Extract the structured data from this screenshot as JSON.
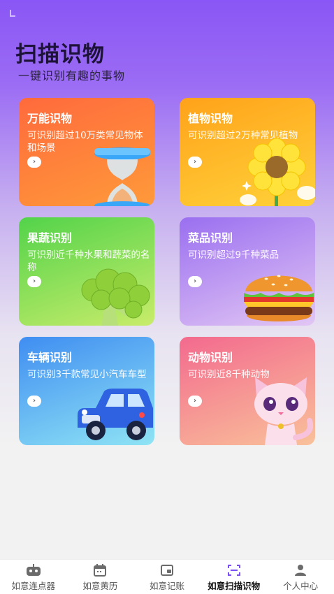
{
  "header": {
    "title": "扫描识物",
    "subtitle": "一键识别有趣的事物"
  },
  "cards": [
    {
      "title": "万能识物",
      "desc": "可识别超过10万类常见物体和场景",
      "icon": "hourglass-icon",
      "color_from": "#ff6a3c",
      "color_to": "#ff9a3a"
    },
    {
      "title": "植物识物",
      "desc": "可识别超过2万种常见植物",
      "icon": "flower-icon",
      "color_from": "#ffa21a",
      "color_to": "#ffd23a"
    },
    {
      "title": "果蔬识别",
      "desc": "可识别近千种水果和蔬菜的名称",
      "icon": "broccoli-icon",
      "color_from": "#52d34a",
      "color_to": "#c8ec6a"
    },
    {
      "title": "菜品识别",
      "desc": "可识别超过9千种菜品",
      "icon": "burger-icon",
      "color_from": "#9a6ff0",
      "color_to": "#e2c6f4"
    },
    {
      "title": "车辆识别",
      "desc": "可识别3千款常见小汽车车型",
      "icon": "car-icon",
      "color_from": "#3f8df2",
      "color_to": "#8fe4f4"
    },
    {
      "title": "动物识别",
      "desc": "可识别近8千种动物",
      "icon": "cat-icon",
      "color_from": "#f36a8e",
      "color_to": "#f9c19a"
    }
  ],
  "tabbar": {
    "items": [
      {
        "label": "如意连点器",
        "icon": "robot-icon",
        "active": false
      },
      {
        "label": "如意黄历",
        "icon": "calendar-icon",
        "active": false
      },
      {
        "label": "如意记账",
        "icon": "ledger-icon",
        "active": false
      },
      {
        "label": "如意扫描识物",
        "icon": "scan-icon",
        "active": true
      },
      {
        "label": "个人中心",
        "icon": "person-icon",
        "active": false
      }
    ],
    "active_color": "#7b4ff0"
  }
}
